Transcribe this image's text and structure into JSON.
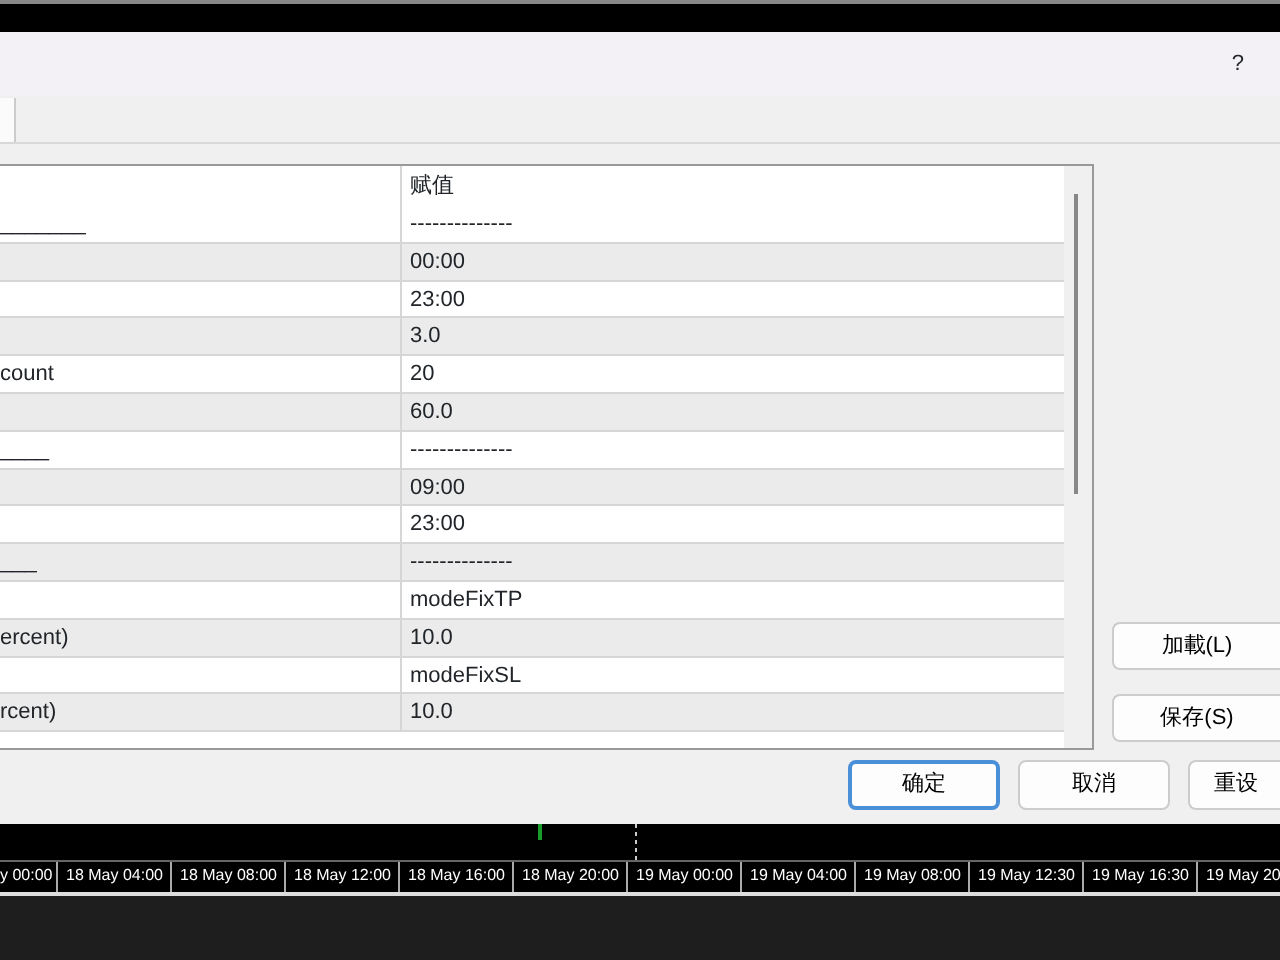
{
  "dialog": {
    "help": "?",
    "tab_visible": true,
    "table": {
      "columns": [
        "",
        "赋值"
      ],
      "rows": [
        {
          "name": "_______",
          "value": "--------------"
        },
        {
          "name": "",
          "value": "00:00"
        },
        {
          "name": "",
          "value": "23:00"
        },
        {
          "name": "",
          "value": "3.0"
        },
        {
          "name": "count",
          "value": "20"
        },
        {
          "name": "",
          "value": "60.0"
        },
        {
          "name": "____",
          "value": "--------------"
        },
        {
          "name": "",
          "value": "09:00"
        },
        {
          "name": "",
          "value": "23:00"
        },
        {
          "name": "___",
          "value": "--------------"
        },
        {
          "name": "",
          "value": "modeFixTP"
        },
        {
          "name": "ercent)",
          "value": "10.0"
        },
        {
          "name": "",
          "value": "modeFixSL"
        },
        {
          "name": "rcent)",
          "value": "10.0"
        }
      ]
    },
    "side_buttons": [
      "加載(L)",
      "保存(S)"
    ],
    "buttons": [
      {
        "label": "确定",
        "default": true
      },
      {
        "label": "取消",
        "default": false
      },
      {
        "label": "重设",
        "default": false
      }
    ]
  },
  "chart": {
    "time_axis": [
      "y 00:00",
      "18 May 04:00",
      "18 May 08:00",
      "18 May 12:00",
      "18 May 16:00",
      "18 May 20:00",
      "19 May 00:00",
      "19 May 04:00",
      "19 May 08:00",
      "19 May 12:30",
      "19 May 16:30",
      "19 May 20"
    ]
  }
}
